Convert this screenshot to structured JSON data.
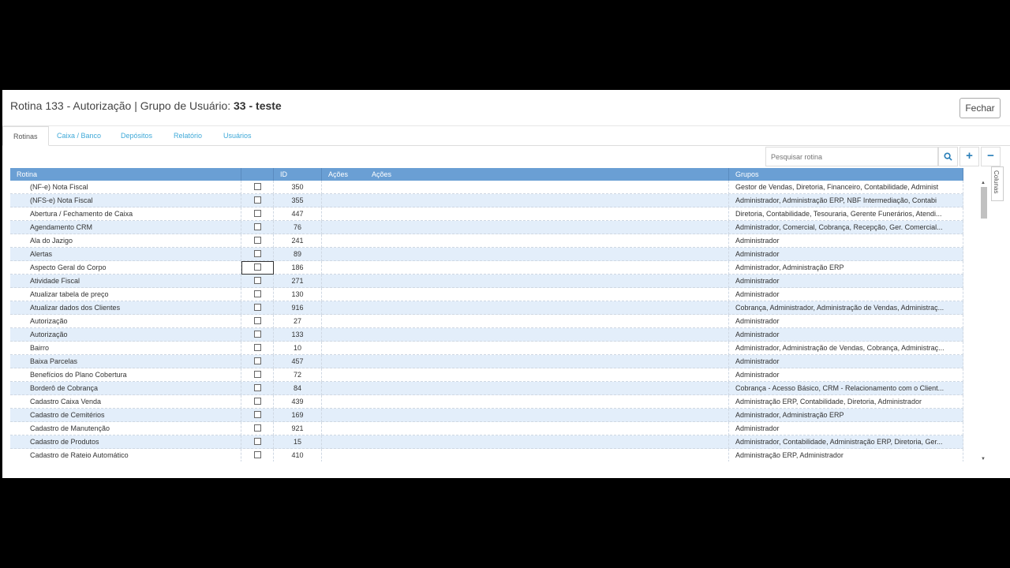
{
  "modal": {
    "title_prefix": "Rotina 133 - Autorização | Grupo de Usuário:",
    "title_group": "33 - teste",
    "close_label": "Fechar"
  },
  "tabs": [
    {
      "label": "Rotinas",
      "active": true
    },
    {
      "label": "Caixa / Banco",
      "active": false
    },
    {
      "label": "Depósitos",
      "active": false
    },
    {
      "label": "Relatório",
      "active": false
    },
    {
      "label": "Usuários",
      "active": false
    }
  ],
  "toolbar": {
    "search_placeholder": "Pesquisar rotina",
    "search_icon": "search-icon",
    "add_label": "+",
    "remove_label": "−"
  },
  "grid": {
    "columns": [
      "Rotina",
      "",
      "ID",
      "Ações",
      "Ações",
      "Grupos"
    ],
    "side_tab_label": "Colunas",
    "rows": [
      {
        "name": "(NF-e) Nota Fiscal",
        "id": "350",
        "groups": "Gestor de Vendas, Diretoria, Financeiro, Contabilidade, Administ"
      },
      {
        "name": "(NFS-e) Nota Fiscal",
        "id": "355",
        "groups": "Administrador, Administração ERP, NBF Intermediação, Contabi"
      },
      {
        "name": "Abertura / Fechamento de Caixa",
        "id": "447",
        "groups": "Diretoria, Contabilidade, Tesouraria, Gerente Funerários, Atendi..."
      },
      {
        "name": "Agendamento CRM",
        "id": "76",
        "groups": "Administrador, Comercial, Cobrança, Recepção, Ger. Comercial..."
      },
      {
        "name": "Ala do Jazigo",
        "id": "241",
        "groups": "Administrador"
      },
      {
        "name": "Alertas",
        "id": "89",
        "groups": "Administrador"
      },
      {
        "name": "Aspecto Geral do Corpo",
        "id": "186",
        "groups": "Administrador, Administração ERP"
      },
      {
        "name": "Atividade Fiscal",
        "id": "271",
        "groups": "Administrador"
      },
      {
        "name": "Atualizar tabela de preço",
        "id": "130",
        "groups": "Administrador"
      },
      {
        "name": "Atualizar dados dos Clientes",
        "id": "916",
        "groups": "Cobrança, Administrador, Administração de Vendas, Administraç..."
      },
      {
        "name": "Autorização",
        "id": "27",
        "groups": "Administrador"
      },
      {
        "name": "Autorização",
        "id": "133",
        "groups": "Administrador"
      },
      {
        "name": "Bairro",
        "id": "10",
        "groups": "Administrador, Administração de Vendas, Cobrança, Administraç..."
      },
      {
        "name": "Baixa Parcelas",
        "id": "457",
        "groups": "Administrador"
      },
      {
        "name": "Benefícios do Plano Cobertura",
        "id": "72",
        "groups": "Administrador"
      },
      {
        "name": "Borderô de Cobrança",
        "id": "84",
        "groups": "Cobrança - Acesso Básico, CRM - Relacionamento com o Client..."
      },
      {
        "name": "Cadastro Caixa Venda",
        "id": "439",
        "groups": "Administração ERP, Contabilidade, Diretoria, Administrador"
      },
      {
        "name": "Cadastro de Cemitérios",
        "id": "169",
        "groups": "Administrador, Administração ERP"
      },
      {
        "name": "Cadastro de Manutenção",
        "id": "921",
        "groups": "Administrador"
      },
      {
        "name": "Cadastro de Produtos",
        "id": "15",
        "groups": "Administrador, Contabilidade, Administração ERP, Diretoria, Ger..."
      },
      {
        "name": "Cadastro de Rateio Automático",
        "id": "410",
        "groups": "Administração ERP, Administrador"
      }
    ]
  }
}
